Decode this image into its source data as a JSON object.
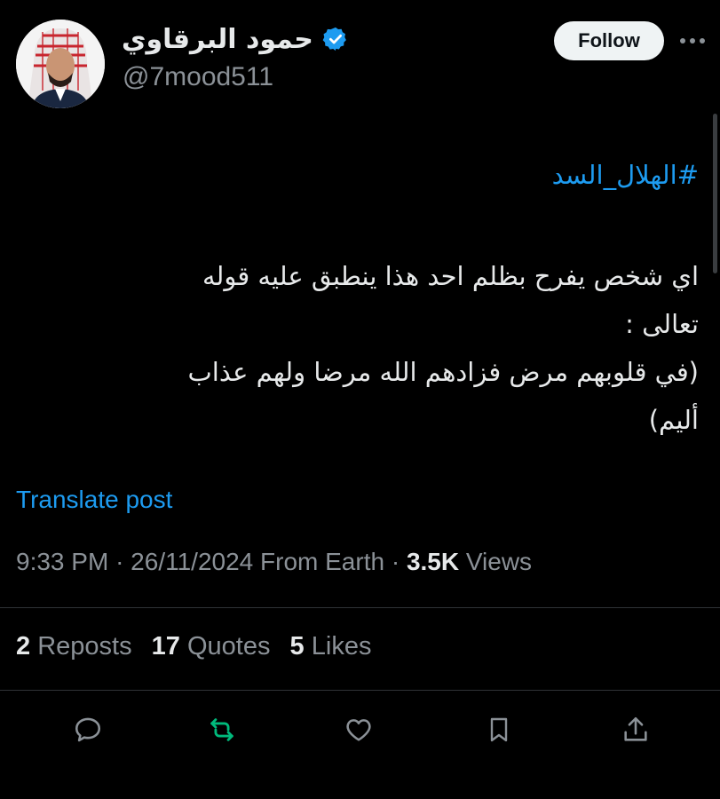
{
  "author": {
    "display_name": "حمود البرقاوي",
    "handle": "@7mood511",
    "verified_icon": "verified-badge-icon",
    "avatar_icon": "avatar"
  },
  "header": {
    "follow_label": "Follow",
    "more_icon": "more-options-icon"
  },
  "tweet": {
    "hashtag": "#الهلال_السد",
    "lines": [
      "اي شخص يفرح بظلم احد هذا ينطبق عليه قوله",
      "تعالى :",
      "(في قلوبهم مرض فزادهم الله مرضا ولهم عذاب",
      "أليم)"
    ]
  },
  "translate_label": "Translate post",
  "meta": {
    "time": "9:33 PM",
    "separator": "·",
    "date": "26/11/2024",
    "source": "From Earth",
    "views_count": "3.5K",
    "views_label": "Views"
  },
  "stats": {
    "reposts_count": "2",
    "reposts_label": "Reposts",
    "quotes_count": "17",
    "quotes_label": "Quotes",
    "likes_count": "5",
    "likes_label": "Likes"
  },
  "actions": [
    "reply-icon",
    "repost-icon",
    "like-icon",
    "bookmark-icon",
    "share-icon"
  ],
  "colors": {
    "background": "#000000",
    "text": "#e7e9ea",
    "muted": "#8b9197",
    "link": "#1d9bf0",
    "repost_active": "#00ba7c",
    "divider": "#2f3336"
  }
}
